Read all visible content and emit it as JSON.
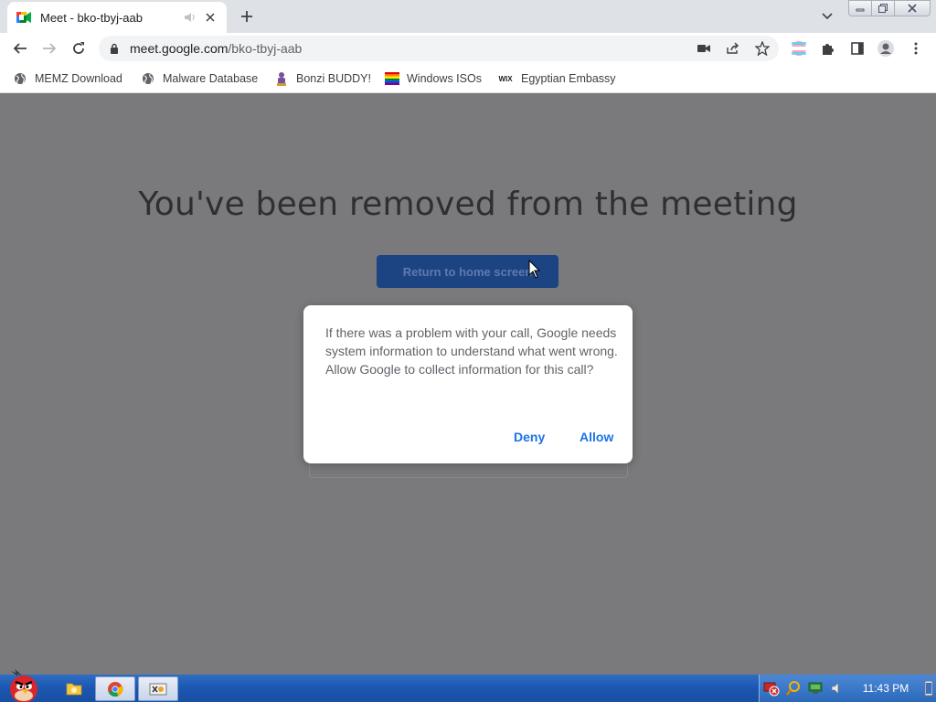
{
  "browser": {
    "tab": {
      "title": "Meet - bko-tbyj-aab"
    },
    "omnibox": {
      "url_host": "meet.google.com",
      "url_path": "/bko-tbyj-aab"
    },
    "bookmarks": [
      {
        "label": "MEMZ Download",
        "icon": "globe-icon"
      },
      {
        "label": "Malware Database",
        "icon": "globe-icon"
      },
      {
        "label": "Bonzi BUDDY!",
        "icon": "bonzi-icon"
      },
      {
        "label": "Windows ISOs",
        "icon": "rainbow-flag-icon"
      },
      {
        "label": "Egyptian Embassy",
        "icon": "wix-icon",
        "icon_text": "WIX"
      }
    ]
  },
  "page": {
    "title": "You've been removed from the meeting",
    "return_button": "Return to home screen"
  },
  "dialog": {
    "message": "If there was a problem with your call, Google needs system information to understand what went wrong. Allow Google to collect information for this call?",
    "deny": "Deny",
    "allow": "Allow"
  },
  "taskbar": {
    "clock": "11:43 PM"
  },
  "colors": {
    "accent": "#1a73e8",
    "return_button_bg": "#1c4382",
    "overlay_bg": "#7a7a7c"
  }
}
